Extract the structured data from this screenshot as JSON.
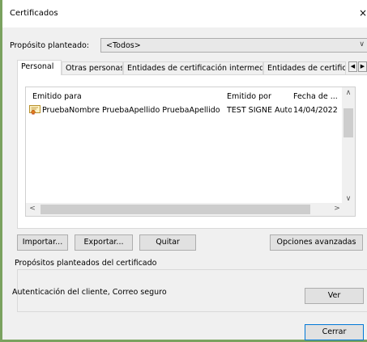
{
  "window": {
    "title": "Certificados",
    "close_glyph": "×"
  },
  "purpose": {
    "label": "Propósito planteado:",
    "value": "<Todos>"
  },
  "tabs": [
    {
      "label": "Personal",
      "active": true
    },
    {
      "label": "Otras personas",
      "active": false
    },
    {
      "label": "Entidades de certificación intermedias",
      "active": false
    },
    {
      "label": "Entidades de certificaci",
      "active": false
    }
  ],
  "list": {
    "columns": [
      "Emitido para",
      "Emitido por",
      "Fecha de ..."
    ],
    "rows": [
      {
        "icon": "certificate-icon",
        "issued_to": "PruebaNombre PruebaApellido PruebaApellido",
        "issued_by": "TEST SIGNE Autori...",
        "date": "14/04/2022"
      }
    ]
  },
  "buttons": {
    "import": "Importar...",
    "export": "Exportar...",
    "remove": "Quitar",
    "advanced": "Opciones avanzadas",
    "view": "Ver",
    "close": "Cerrar"
  },
  "purposes_group": {
    "title": "Propósitos planteados del certificado",
    "text": "Autenticación del cliente, Correo seguro"
  },
  "colors": {
    "window_border": "#7aa25f",
    "dialog_bg": "#f0f0f0"
  }
}
